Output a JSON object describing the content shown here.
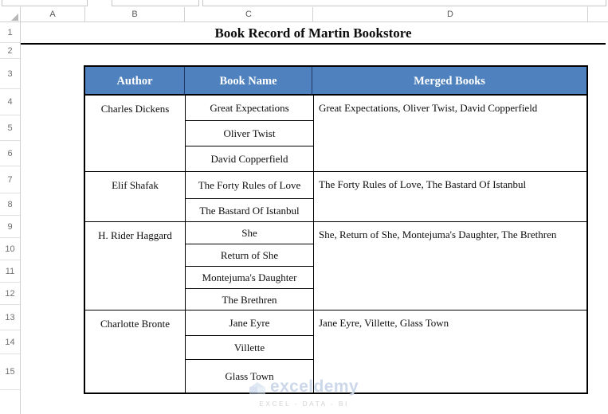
{
  "app": {
    "type": "spreadsheet",
    "accent_blue": "#4E81BD",
    "header_text_color": "#FFFFFF",
    "grid_line_color": "#D0D0D0"
  },
  "grid": {
    "column_headers": [
      "A",
      "B",
      "C",
      "D"
    ],
    "row_headers": [
      "1",
      "2",
      "3",
      "4",
      "5",
      "6",
      "7",
      "8",
      "9",
      "10",
      "11",
      "12",
      "13",
      "14",
      "15"
    ]
  },
  "sheet": {
    "title": "Book Record of Martin Bookstore",
    "table": {
      "headers": [
        "Author",
        "Book Name",
        "Merged Books"
      ],
      "groups": [
        {
          "author": "Charles Dickens",
          "books": [
            "Great Expectations",
            "Oliver Twist",
            "David Copperfield"
          ],
          "merged": "Great Expectations, Oliver Twist, David Copperfield"
        },
        {
          "author": "Elif Shafak",
          "books": [
            "The Forty Rules of Love",
            "The Bastard Of Istanbul"
          ],
          "merged": "The Forty Rules of Love, The Bastard Of Istanbul"
        },
        {
          "author": "H. Rider Haggard",
          "books": [
            "She",
            "Return of She",
            "Montejuma's Daughter",
            "The Brethren"
          ],
          "merged": "She, Return of She, Montejuma's Daughter, The Brethren"
        },
        {
          "author": "Charlotte Bronte",
          "books": [
            "Jane Eyre",
            "Villette",
            "Glass Town"
          ],
          "merged": "Jane Eyre, Villette, Glass Town"
        }
      ]
    }
  },
  "watermark": {
    "name": "exceldemy",
    "tagline": "EXCEL - DATA - BI",
    "icon": "cube-icon"
  }
}
